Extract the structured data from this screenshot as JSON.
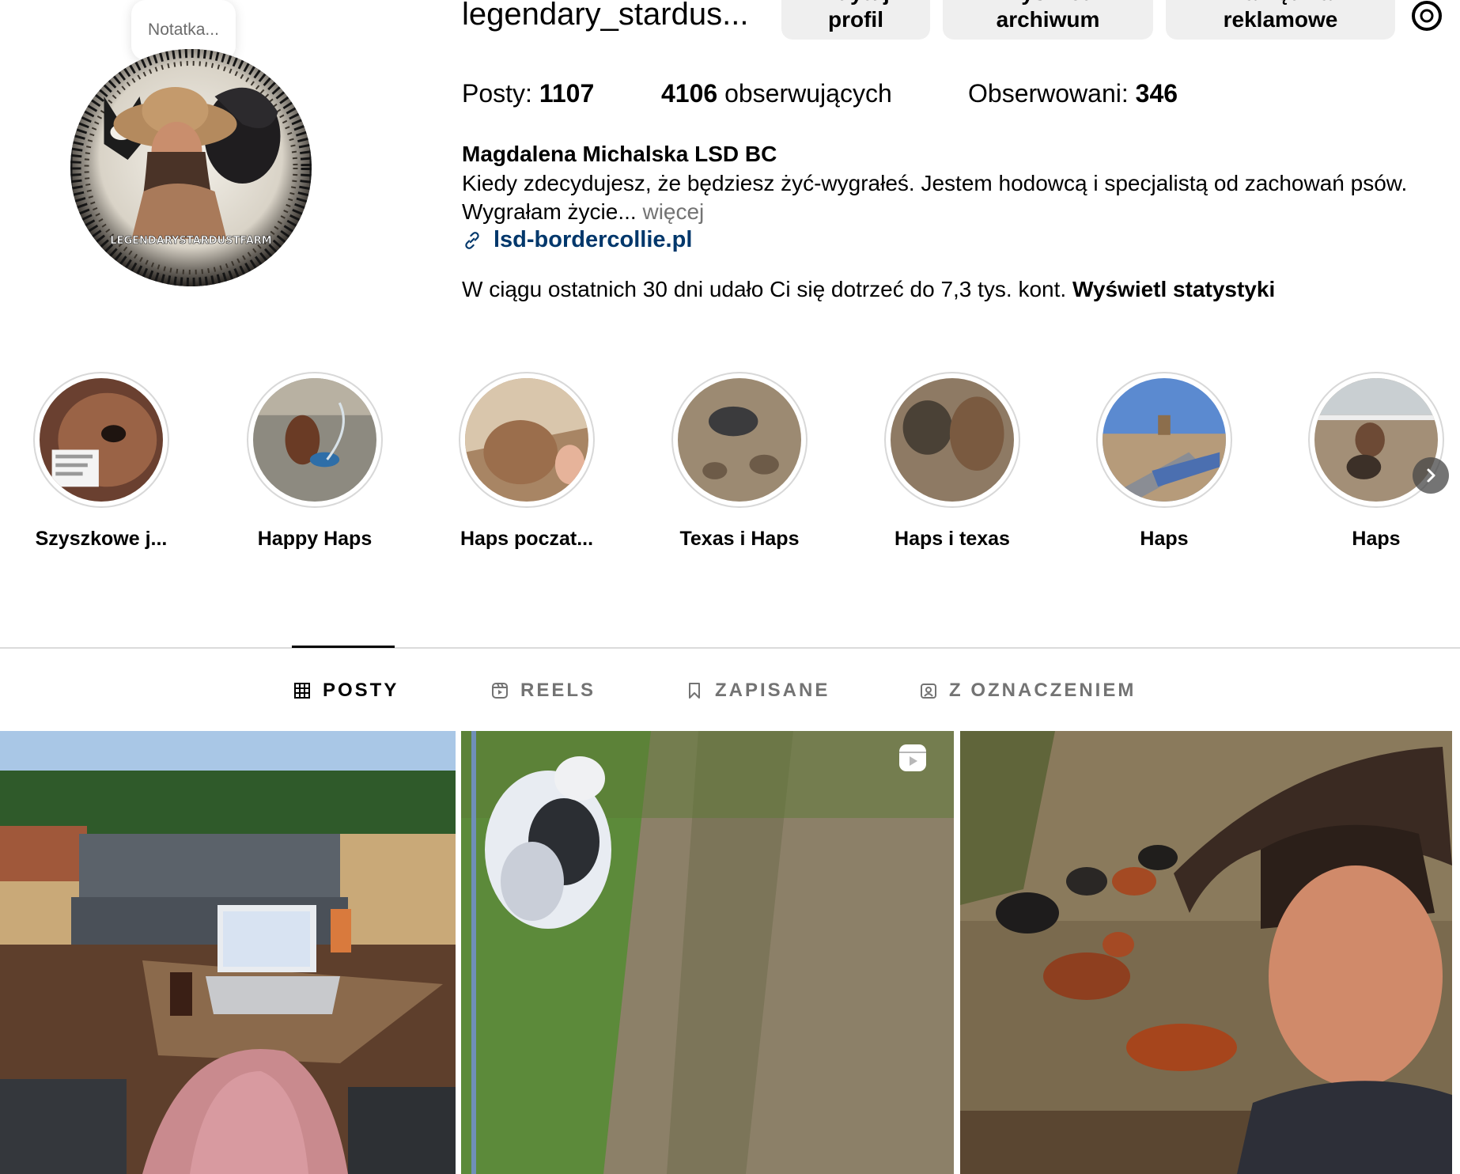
{
  "profile": {
    "note": "Notatka...",
    "username": "legendary_stardus...",
    "buttons": {
      "edit_line1": "Edytuj",
      "edit_line2": "profil",
      "archive_line1": "Wyświetl",
      "archive_line2": "archiwum",
      "tools_line1": "Narzędzia",
      "tools_line2": "reklamowe"
    },
    "settings_icon": "gear-icon",
    "avatar_text": "LEGENDARYSTARDUSTFARM",
    "stats": {
      "posts_label": "Posty: ",
      "posts_value": "1107",
      "followers_value": "4106",
      "followers_label": " obserwujących",
      "following_label": "Obserwowani: ",
      "following_value": "346"
    },
    "full_name": "Magdalena Michalska LSD BC",
    "bio_text": "Kiedy zdecydujesz, że będziesz żyć-wygrałeś. Jestem hodowcą i specjalistą od zachowań psów. Wygrałam życie... ",
    "bio_more": "więcej",
    "link_icon": "link-icon",
    "link": "lsd-bordercollie.pl",
    "reach_text": "W ciągu ostatnich 30 dni udało Ci się dotrzeć do 7,3 tys. kont. ",
    "reach_link": "Wyświetl statystyki"
  },
  "highlights": [
    {
      "label": "Szyszkowe j..."
    },
    {
      "label": "Happy Haps"
    },
    {
      "label": "Haps poczat..."
    },
    {
      "label": "Texas i Haps"
    },
    {
      "label": "Haps i texas"
    },
    {
      "label": "Haps"
    },
    {
      "label": "Haps"
    }
  ],
  "tabs": [
    {
      "label": "POSTY",
      "icon": "grid-icon",
      "active": true
    },
    {
      "label": "REELS",
      "icon": "reels-icon",
      "active": false
    },
    {
      "label": "ZAPISANE",
      "icon": "bookmark-icon",
      "active": false
    },
    {
      "label": "Z OZNACZENIEM",
      "icon": "tagged-icon",
      "active": false
    }
  ],
  "colors": {
    "link": "#00376b",
    "muted": "#737373",
    "button_bg": "#efefef",
    "divider": "#dbdbdb"
  }
}
